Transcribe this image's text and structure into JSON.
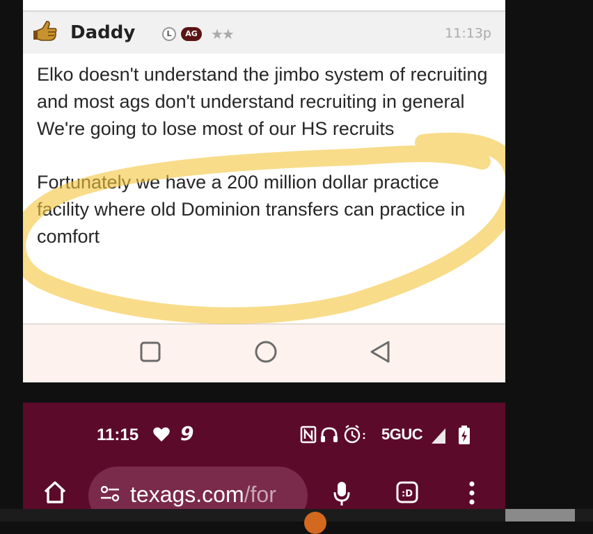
{
  "post": {
    "username": "Daddy",
    "badge_l": "L",
    "badge_ag": "AG",
    "stars": "★★",
    "timestamp": "11:13p",
    "paragraphs": [
      "Elko doesn't understand the jimbo system of recruiting and most ags don't understand recruiting in general We're going to lose most of our HS recruits",
      "Fortunately we have a 200 million dollar practice facility where old Dominion transfers can practice in comfort"
    ],
    "highlight_color": "#f3c53b"
  },
  "icons": {
    "reaction": "thumbs-up-hand-icon",
    "recents": "square-icon",
    "home": "circle-icon",
    "back": "triangle-back-icon"
  },
  "browser": {
    "status_time": "11:15",
    "network": "5GUC",
    "url_host": "texags.com",
    "url_rest": "/for",
    "theme_color": "#5c0a2a"
  },
  "colors": {
    "background": "#101010",
    "badge_ag": "#5a1414",
    "nav_bar": "#fdf2ee"
  }
}
